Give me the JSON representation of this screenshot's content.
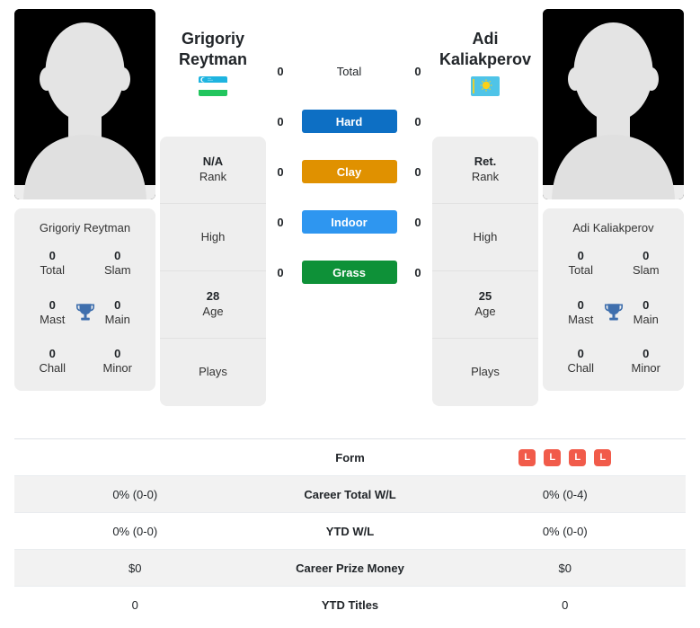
{
  "players": {
    "left": {
      "name_line1": "Grigoriy",
      "name_line2": "Reytman",
      "full_name": "Grigoriy Reytman",
      "country": "Uzbekistan",
      "flag_icon": "uzbekistan-flag-icon",
      "photo_icon": "player-avatar-placeholder",
      "rank_value": "N/A",
      "rank_label": "Rank",
      "high_value": "",
      "high_label": "High",
      "age_value": "28",
      "age_label": "Age",
      "plays_value": "",
      "plays_label": "Plays",
      "titles": [
        {
          "num": "0",
          "label": "Total"
        },
        {
          "num": "0",
          "label": "Slam"
        },
        {
          "num": "0",
          "label": "Mast"
        },
        {
          "num": "0",
          "label": "Main"
        },
        {
          "num": "0",
          "label": "Chall"
        },
        {
          "num": "0",
          "label": "Minor"
        }
      ]
    },
    "right": {
      "name_line1": "Adi",
      "name_line2": "Kaliakperov",
      "full_name": "Adi Kaliakperov",
      "country": "Kazakhstan",
      "flag_icon": "kazakhstan-flag-icon",
      "photo_icon": "player-avatar-placeholder",
      "rank_value": "Ret.",
      "rank_label": "Rank",
      "high_value": "",
      "high_label": "High",
      "age_value": "25",
      "age_label": "Age",
      "plays_value": "",
      "plays_label": "Plays",
      "titles": [
        {
          "num": "0",
          "label": "Total"
        },
        {
          "num": "0",
          "label": "Slam"
        },
        {
          "num": "0",
          "label": "Mast"
        },
        {
          "num": "0",
          "label": "Main"
        },
        {
          "num": "0",
          "label": "Chall"
        },
        {
          "num": "0",
          "label": "Minor"
        }
      ]
    }
  },
  "surfaces": [
    {
      "label": "Total",
      "left": "0",
      "right": "0",
      "color": "transparent",
      "plain": true
    },
    {
      "label": "Hard",
      "left": "0",
      "right": "0",
      "color": "#0d6fc4",
      "plain": false
    },
    {
      "label": "Clay",
      "left": "0",
      "right": "0",
      "color": "#e09100",
      "plain": false
    },
    {
      "label": "Indoor",
      "left": "0",
      "right": "0",
      "color": "#2e96f0",
      "plain": false
    },
    {
      "label": "Grass",
      "left": "0",
      "right": "0",
      "color": "#0e9138",
      "plain": false
    }
  ],
  "comparison_table": [
    {
      "label": "Form",
      "left": "",
      "right": "",
      "type": "form",
      "left_form": [],
      "right_form": [
        "L",
        "L",
        "L",
        "L"
      ],
      "alt": false
    },
    {
      "label": "Career Total W/L",
      "left": "0% (0-0)",
      "right": "0% (0-4)",
      "type": "text",
      "alt": true
    },
    {
      "label": "YTD W/L",
      "left": "0% (0-0)",
      "right": "0% (0-0)",
      "type": "text",
      "alt": false
    },
    {
      "label": "Career Prize Money",
      "left": "$0",
      "right": "$0",
      "type": "text",
      "alt": true
    },
    {
      "label": "YTD Titles",
      "left": "0",
      "right": "0",
      "type": "text",
      "alt": false
    }
  ],
  "colors": {
    "hard": "#0d6fc4",
    "clay": "#e09100",
    "indoor": "#2e96f0",
    "grass": "#0e9138",
    "loss_badge": "#f15b4a",
    "trophy": "#3f6fad",
    "card_bg": "#eeeeee"
  },
  "icons": {
    "trophy": "trophy-icon",
    "avatar": "person-silhouette-icon"
  }
}
